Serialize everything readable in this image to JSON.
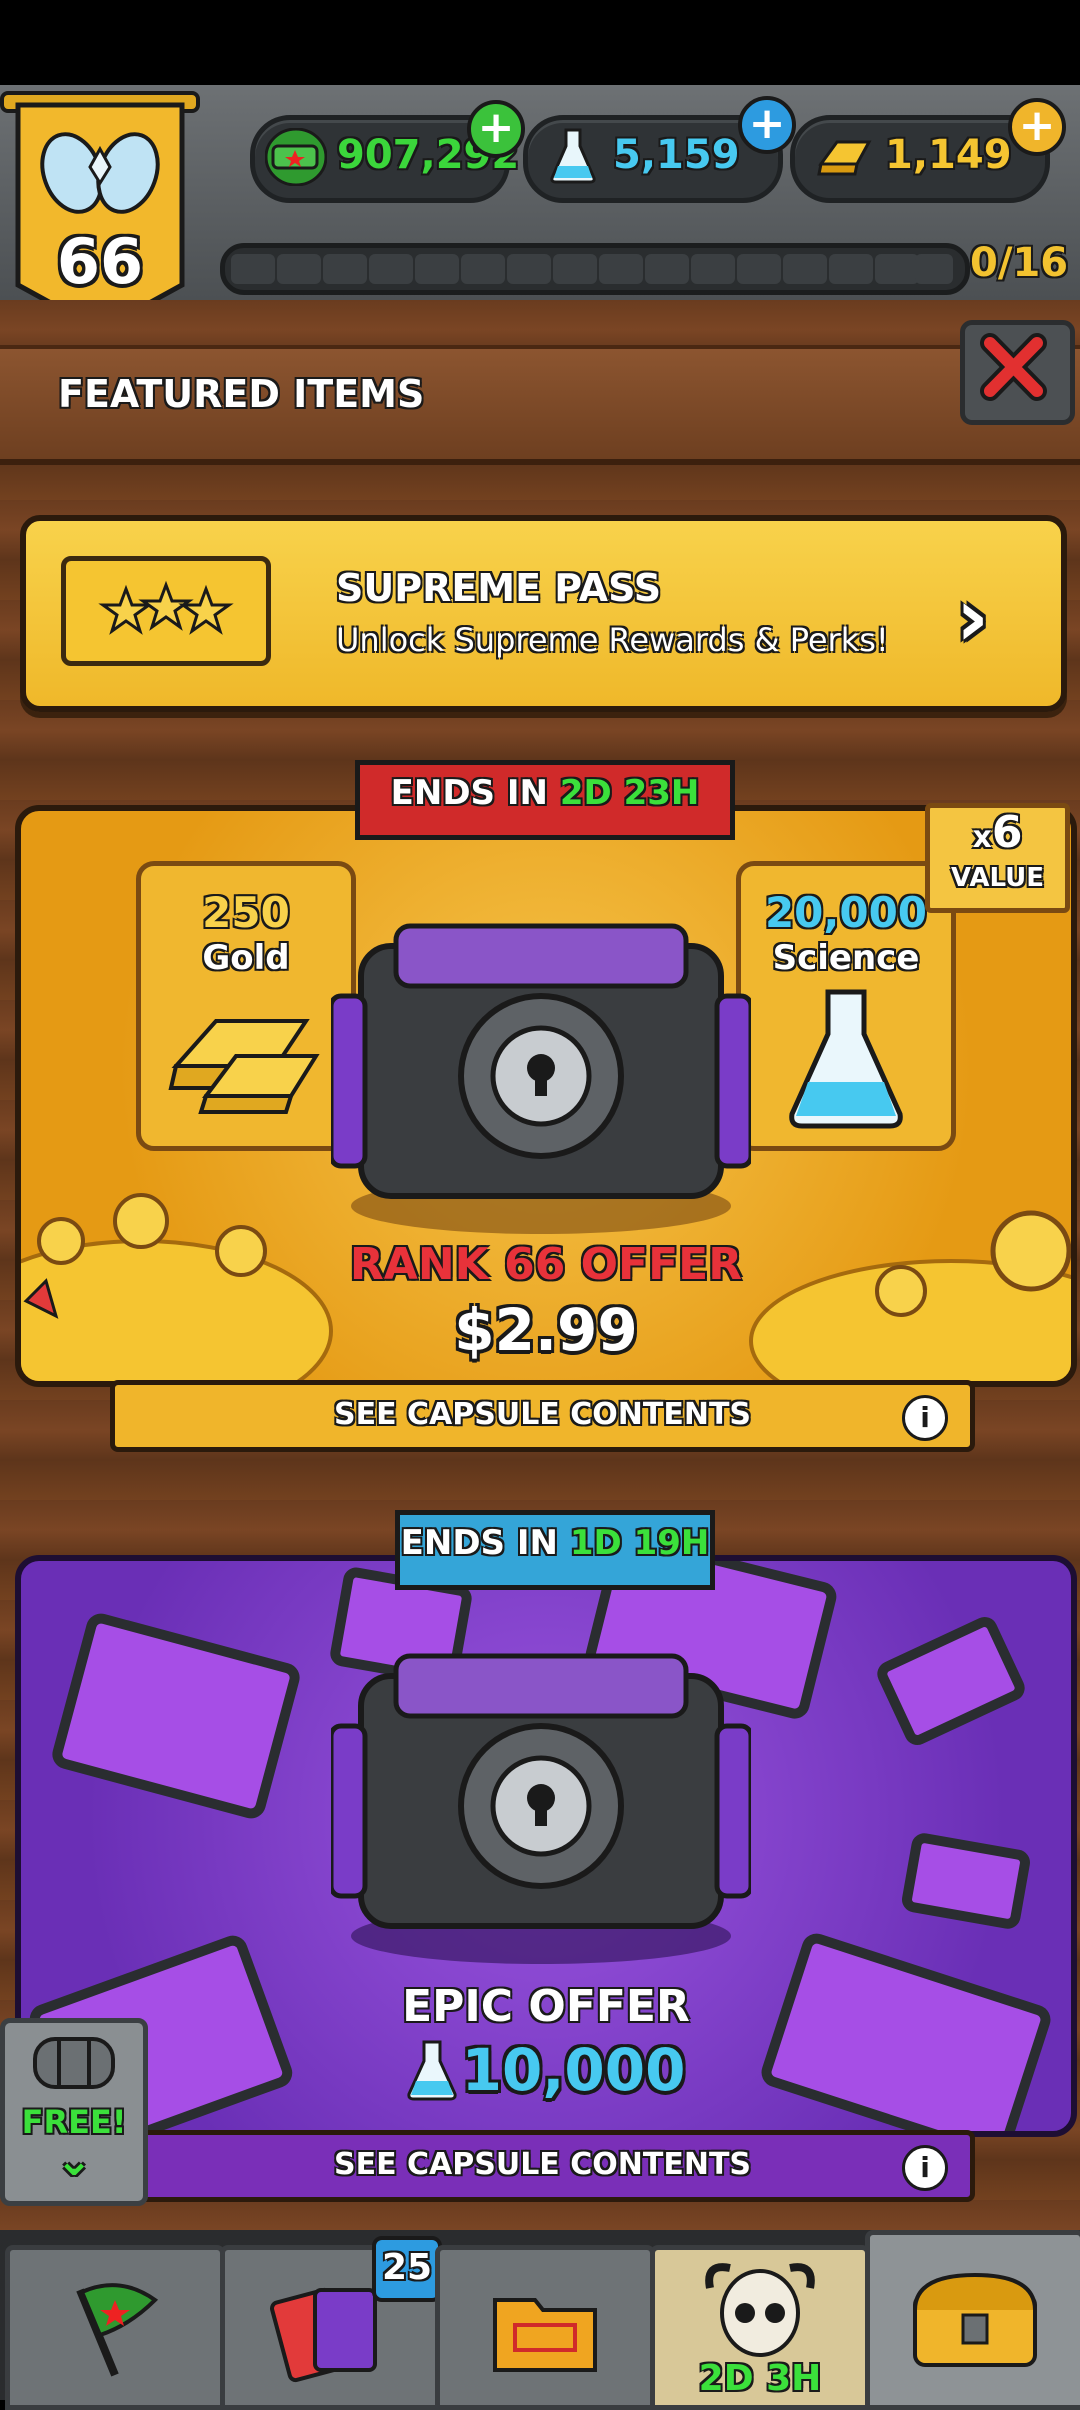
{
  "player": {
    "rank": "66"
  },
  "currencies": [
    {
      "name": "cash",
      "value": "907,292",
      "icon": "cash-icon",
      "color": "#3bd63b"
    },
    {
      "name": "science",
      "value": "5,159",
      "icon": "flask-icon",
      "color": "#47c9f0"
    },
    {
      "name": "gold",
      "value": "1,149",
      "icon": "gold-bar-icon",
      "color": "#f5c531"
    }
  ],
  "progress": {
    "label": "0/16",
    "fraction": 0.0
  },
  "header": {
    "title": "FEATURED ITEMS"
  },
  "supreme_pass": {
    "title": "SUPREME PASS",
    "subtitle": "Unlock Supreme Rewards & Perks!"
  },
  "offer_rank": {
    "ends_prefix": "ENDS IN",
    "ends_days": "2D",
    "ends_hours": "23H",
    "multiplier_prefix": "x",
    "multiplier": "6",
    "multiplier_label": "VALUE",
    "left_reward": {
      "amount": "250",
      "label": "Gold"
    },
    "right_reward": {
      "amount": "20,000",
      "label": "Science"
    },
    "title": "RANK 66 OFFER",
    "price": "$2.99",
    "see_contents": "SEE CAPSULE CONTENTS"
  },
  "offer_epic": {
    "ends_prefix": "ENDS IN",
    "ends_days": "1D",
    "ends_hours": "19H",
    "title": "EPIC OFFER",
    "price": "10,000",
    "see_contents": "SEE CAPSULE CONTENTS"
  },
  "free_chest": {
    "label": "FREE!"
  },
  "bottom_nav": {
    "cards_badge": "25",
    "event_timer": "2D 3H"
  },
  "colors": {
    "accent_gold": "#f5c531",
    "epic_purple": "#7a3cc8",
    "timer_green": "#3be03b"
  }
}
